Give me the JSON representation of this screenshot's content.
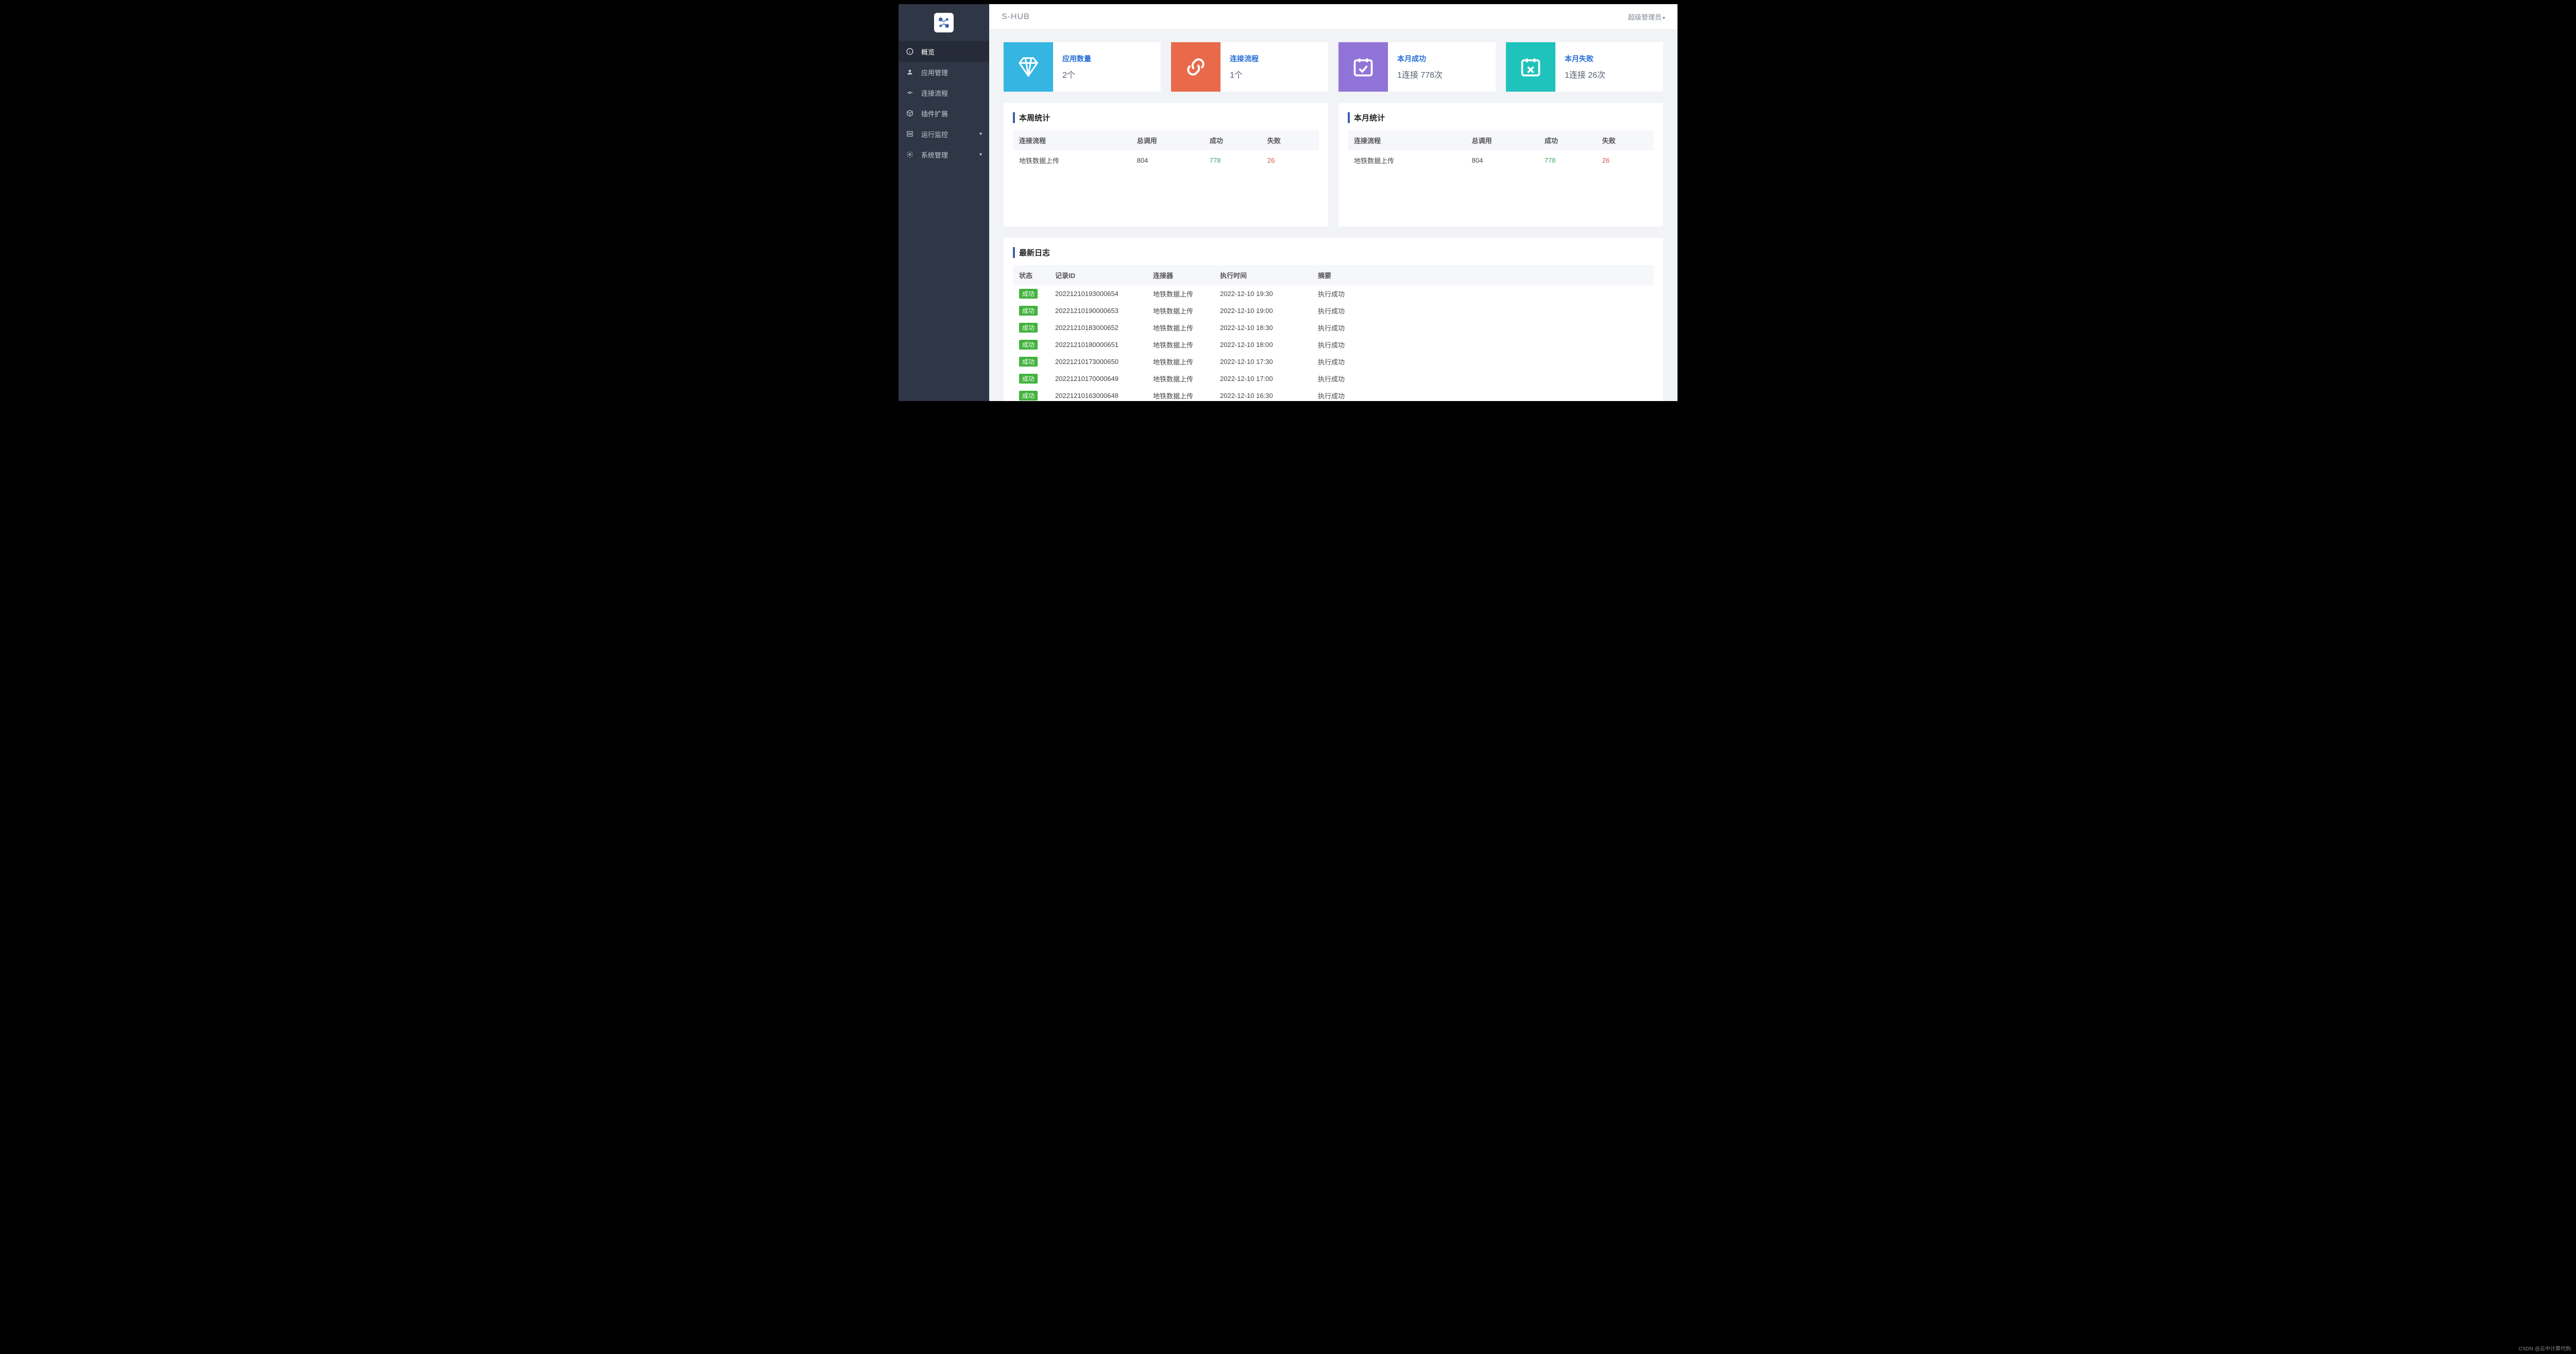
{
  "header": {
    "brand": "S-HUB",
    "user_label": "超级管理员"
  },
  "sidebar": {
    "items": [
      {
        "label": "概览",
        "icon": "info"
      },
      {
        "label": "应用管理",
        "icon": "user"
      },
      {
        "label": "连接流程",
        "icon": "link"
      },
      {
        "label": "插件扩展",
        "icon": "cube"
      },
      {
        "label": "运行监控",
        "icon": "server",
        "caret": true
      },
      {
        "label": "系统管理",
        "icon": "gear",
        "caret": true
      }
    ]
  },
  "stats": {
    "apps": {
      "title": "应用数量",
      "value": "2个"
    },
    "flows": {
      "title": "连接流程",
      "value": "1个"
    },
    "success": {
      "title": "本月成功",
      "value": "1连接 778次"
    },
    "fail": {
      "title": "本月失败",
      "value": "1连接 26次"
    }
  },
  "week_stats": {
    "title": "本周统计",
    "headers": {
      "flow": "连接流程",
      "total": "总调用",
      "success": "成功",
      "fail": "失败"
    },
    "row": {
      "flow": "地铁数据上传",
      "total": "804",
      "success": "778",
      "fail": "26"
    }
  },
  "month_stats": {
    "title": "本月统计",
    "headers": {
      "flow": "连接流程",
      "total": "总调用",
      "success": "成功",
      "fail": "失败"
    },
    "row": {
      "flow": "地铁数据上传",
      "total": "804",
      "success": "778",
      "fail": "26"
    }
  },
  "logs": {
    "title": "最新日志",
    "headers": {
      "status": "状态",
      "id": "记录ID",
      "connector": "连接器",
      "time": "执行时间",
      "summary": "摘要"
    },
    "success_label": "成功",
    "rows": [
      {
        "id": "20221210193000654",
        "connector": "地铁数据上传",
        "time": "2022-12-10 19:30",
        "summary": "执行成功"
      },
      {
        "id": "20221210190000653",
        "connector": "地铁数据上传",
        "time": "2022-12-10 19:00",
        "summary": "执行成功"
      },
      {
        "id": "20221210183000652",
        "connector": "地铁数据上传",
        "time": "2022-12-10 18:30",
        "summary": "执行成功"
      },
      {
        "id": "20221210180000651",
        "connector": "地铁数据上传",
        "time": "2022-12-10 18:00",
        "summary": "执行成功"
      },
      {
        "id": "20221210173000650",
        "connector": "地铁数据上传",
        "time": "2022-12-10 17:30",
        "summary": "执行成功"
      },
      {
        "id": "20221210170000649",
        "connector": "地铁数据上传",
        "time": "2022-12-10 17:00",
        "summary": "执行成功"
      },
      {
        "id": "20221210163000648",
        "connector": "地铁数据上传",
        "time": "2022-12-10 16:30",
        "summary": "执行成功"
      }
    ]
  },
  "watermark": "CSDN @云中计算代购"
}
